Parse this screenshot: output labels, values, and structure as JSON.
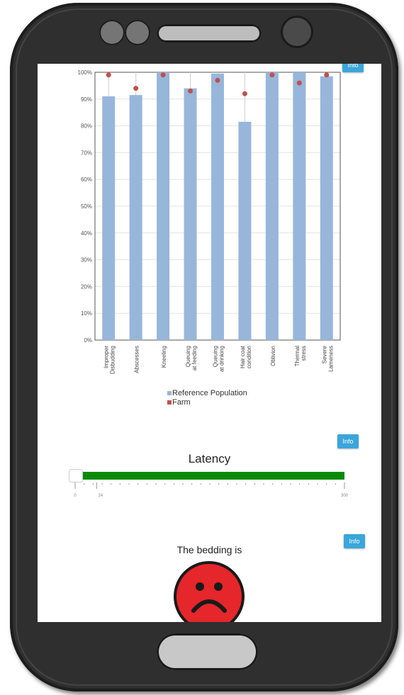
{
  "info_buttons": {
    "top": "Info",
    "latency": "Info",
    "bedding": "Info"
  },
  "chart_data": {
    "type": "bar",
    "categories": [
      [
        "Improper",
        "Disbudding"
      ],
      [
        "Abscesses"
      ],
      [
        "Kneeling"
      ],
      [
        "Queuing",
        "at feeding"
      ],
      [
        "Queuing",
        "at drinking"
      ],
      [
        "Hair coat",
        "condition"
      ],
      [
        "Oblivion"
      ],
      [
        "Thermal",
        "stress"
      ],
      [
        "Severe",
        "Lameness"
      ]
    ],
    "series": [
      {
        "name": "Reference Population",
        "type": "bar",
        "color": "#97b6da",
        "values": [
          91,
          91.5,
          100,
          94,
          99.5,
          81.5,
          100,
          100,
          98.5
        ]
      },
      {
        "name": "Farm",
        "type": "scatter",
        "color": "#c0504d",
        "values": [
          99,
          94,
          99,
          93,
          97,
          92,
          99,
          96,
          99
        ]
      }
    ],
    "ylim": [
      0,
      100
    ],
    "yticks": [
      "0%",
      "10%",
      "20%",
      "30%",
      "40%",
      "50%",
      "60%",
      "70%",
      "80%",
      "90%",
      "100%"
    ],
    "grid": true,
    "legend_position": "bottom"
  },
  "latency": {
    "title": "Latency",
    "min": 0,
    "max": 300,
    "value": 24,
    "tick_labels": [
      "0",
      "24",
      "300"
    ]
  },
  "bedding": {
    "title": "The bedding is",
    "face_icon": "sad-face-icon",
    "face_color": "#e5262b"
  }
}
